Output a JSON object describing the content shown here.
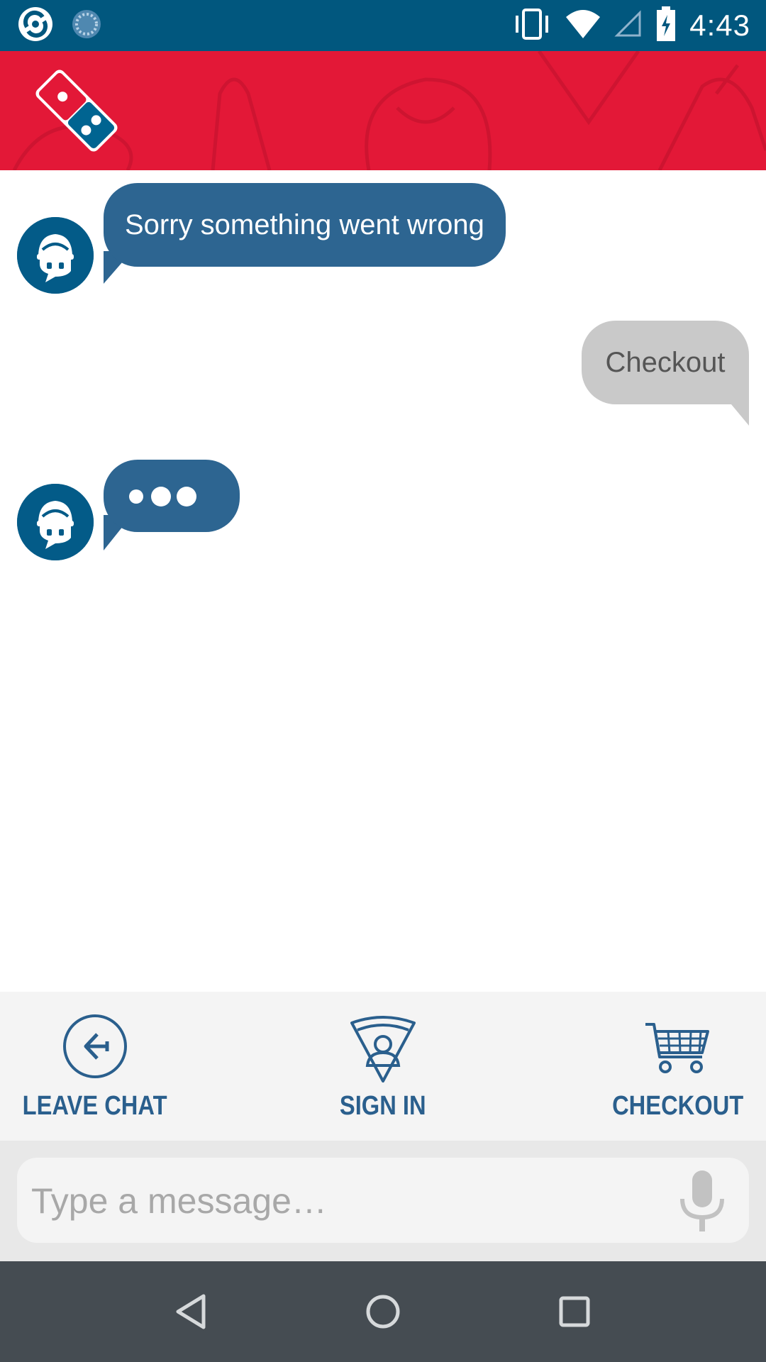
{
  "status_bar": {
    "time": "4:43",
    "icons": [
      "app-notification-icon",
      "sync-notification-icon",
      "vibrate-icon",
      "wifi-icon",
      "cellular-signal-icon",
      "battery-charging-icon"
    ]
  },
  "header": {
    "logo": "dominos-logo-icon",
    "brand_color": "#e31837"
  },
  "messages": [
    {
      "sender": "bot",
      "text": "Sorry something went wrong",
      "avatar": "bot-avatar-icon"
    },
    {
      "sender": "user",
      "text": "Checkout"
    },
    {
      "sender": "bot",
      "typing": true,
      "text": "",
      "avatar": "bot-avatar-icon"
    }
  ],
  "quick_actions": [
    {
      "label": "LEAVE CHAT",
      "icon": "back-arrow-circle-icon"
    },
    {
      "label": "SIGN IN",
      "icon": "user-pizza-slice-icon"
    },
    {
      "label": "CHECKOUT",
      "icon": "shopping-cart-icon"
    }
  ],
  "composer": {
    "placeholder": "Type a message…",
    "value": "",
    "mic_icon": "microphone-icon"
  },
  "nav_bar": {
    "buttons": [
      "back-icon",
      "home-icon",
      "recents-icon"
    ]
  },
  "colors": {
    "status_bar": "#01577e",
    "bot_bubble": "#2d6591",
    "user_bubble": "#c9c9c9",
    "accent_blue": "#2a5f8d",
    "nav_bar": "#454c52"
  }
}
